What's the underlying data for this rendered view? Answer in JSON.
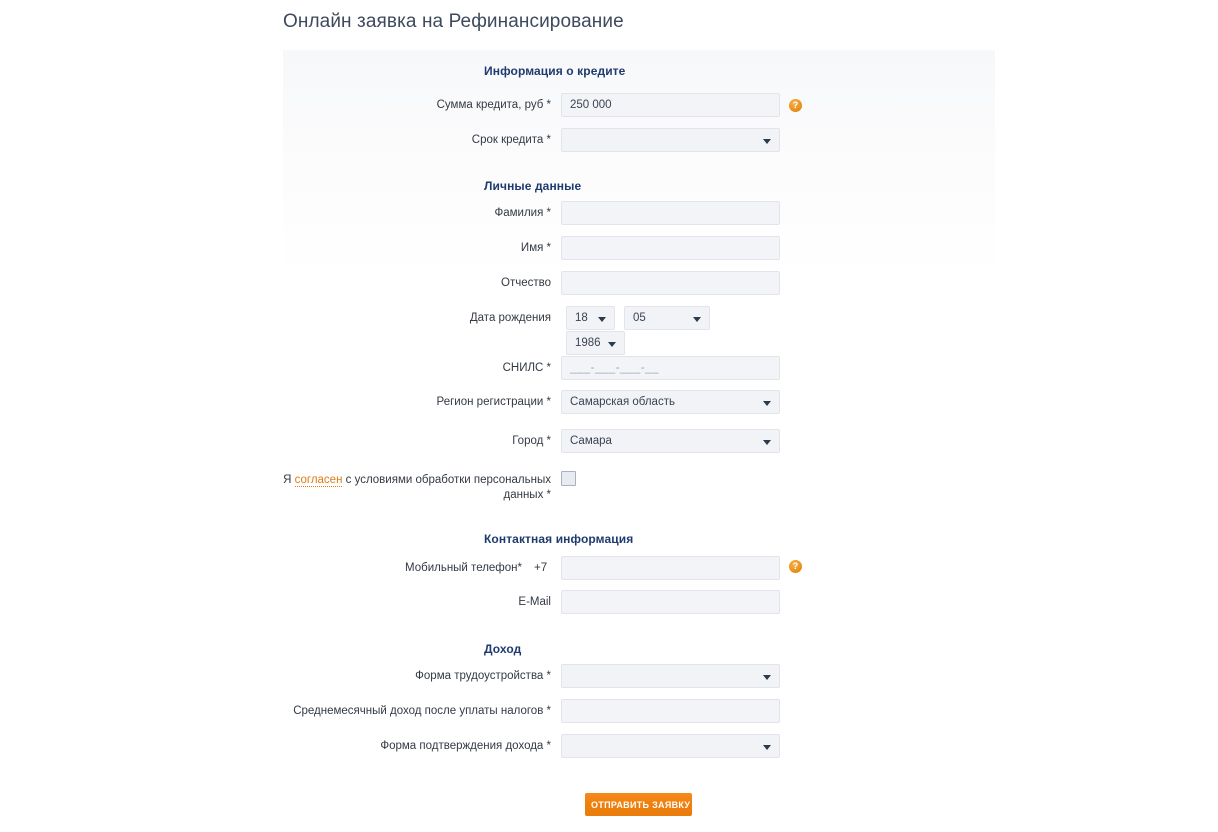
{
  "page": {
    "title": "Онлайн заявка на Рефинансирование"
  },
  "sections": {
    "credit": {
      "heading": "Информация о кредите",
      "amount_label": "Сумма кредита, руб *",
      "amount_value": "250 000",
      "amount_help_icon": "help-circle-icon",
      "term_label": "Срок кредита *",
      "term_value": ""
    },
    "personal": {
      "heading": "Личные данные",
      "lastname_label": "Фамилия *",
      "lastname_value": "",
      "firstname_label": "Имя *",
      "firstname_value": "",
      "middlename_label": "Отчество",
      "middlename_value": "",
      "birthdate_label": "Дата рождения",
      "birth_day": "18",
      "birth_month": "05",
      "birth_year": "1986",
      "snils_label": "СНИЛС *",
      "snils_mask": "___-___-___-__",
      "region_label": "Регион регистрации *",
      "region_value": "Самарская область",
      "city_label": "Город *",
      "city_value": "Самара",
      "consent_prefix": "Я ",
      "consent_link": "согласен",
      "consent_suffix_line1": " с условиями обработки персональных",
      "consent_suffix_line2": "данных *"
    },
    "contact": {
      "heading": "Контактная информация",
      "phone_label": "Мобильный телефон*",
      "phone_prefix": "+7",
      "phone_value": "",
      "phone_help_icon": "help-circle-icon",
      "email_label": "E-Mail",
      "email_value": ""
    },
    "income": {
      "heading": "Доход",
      "employment_label": "Форма трудоустройства *",
      "employment_value": "",
      "monthly_income_label": "Среднемесячный доход после уплаты налогов *",
      "monthly_income_value": "",
      "income_proof_label": "Форма подтверждения дохода *",
      "income_proof_value": ""
    }
  },
  "submit": {
    "label": "ОТПРАВИТЬ ЗАЯВКУ"
  },
  "colors": {
    "accent_orange": "#ef7f0d",
    "heading_navy": "#1f3a6e",
    "link_orange": "#e07c13",
    "title_text": "#3d4a5c"
  }
}
